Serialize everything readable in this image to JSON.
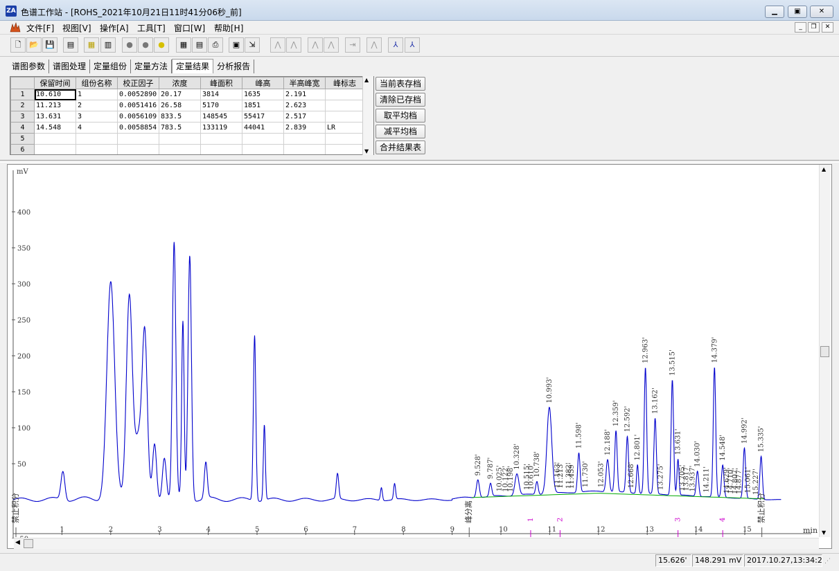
{
  "window": {
    "title": "色谱工作站 - [ROHS_2021年10月21日11时41分06秒_前]",
    "icon_label": "ZA"
  },
  "menu": [
    "文件[F]",
    "视图[V]",
    "操作[A]",
    "工具[T]",
    "窗口[W]",
    "帮助[H]"
  ],
  "tabs": [
    "谱图参数",
    "谱图处理",
    "定量组份",
    "定量方法",
    "定量结果",
    "分析报告"
  ],
  "active_tab": "定量结果",
  "results_table": {
    "headers": [
      "保留时间",
      "组份名称",
      "校正因子",
      "浓度",
      "峰面积",
      "峰高",
      "半高峰宽",
      "峰标志"
    ],
    "rows": [
      {
        "index": "1",
        "cells": [
          "10.610",
          "1",
          "0.0052890",
          "20.17",
          "3814",
          "1635",
          "2.191",
          ""
        ]
      },
      {
        "index": "2",
        "cells": [
          "11.213",
          "2",
          "0.0051416",
          "26.58",
          "5170",
          "1851",
          "2.623",
          ""
        ]
      },
      {
        "index": "3",
        "cells": [
          "13.631",
          "3",
          "0.0056109",
          "833.5",
          "148545",
          "55417",
          "2.517",
          ""
        ]
      },
      {
        "index": "4",
        "cells": [
          "14.548",
          "4",
          "0.0058854",
          "783.5",
          "133119",
          "44041",
          "2.839",
          "LR"
        ]
      },
      {
        "index": "5",
        "cells": [
          "",
          "",
          "",
          "",
          "",
          "",
          "",
          ""
        ]
      },
      {
        "index": "6",
        "cells": [
          "",
          "",
          "",
          "",
          "",
          "",
          "",
          ""
        ]
      }
    ]
  },
  "action_buttons": [
    "当前表存档",
    "清除已存档",
    "取平均档",
    "减平均档",
    "合并结果表"
  ],
  "chart_data": {
    "type": "line",
    "ylabel": "mV",
    "xlabel": "min",
    "xlim": [
      0.0,
      16.5
    ],
    "ylim": [
      -50,
      450
    ],
    "x_ticks": [
      "1",
      "2",
      "3",
      "4",
      "5",
      "6",
      "7",
      "8",
      "9",
      "10",
      "11",
      "12",
      "13",
      "14",
      "15"
    ],
    "y_ticks": [
      "-50",
      "50",
      "100",
      "150",
      "200",
      "250",
      "300",
      "350",
      "400"
    ],
    "line_color": "#0000cc",
    "baseline_color": "#00aa00",
    "peaks": [
      {
        "t": 1.02,
        "h": 40,
        "w": 0.04
      },
      {
        "t": 2.0,
        "h": 300,
        "w": 0.08
      },
      {
        "t": 2.38,
        "h": 275,
        "w": 0.06
      },
      {
        "t": 2.7,
        "h": 190,
        "w": 0.05
      },
      {
        "t": 2.58,
        "h": 90,
        "w": 0.1
      },
      {
        "t": 2.9,
        "h": 75,
        "w": 0.04
      },
      {
        "t": 3.1,
        "h": 60,
        "w": 0.04
      },
      {
        "t": 3.3,
        "h": 355,
        "w": 0.035
      },
      {
        "t": 3.48,
        "h": 245,
        "w": 0.025
      },
      {
        "t": 3.62,
        "h": 340,
        "w": 0.035
      },
      {
        "t": 3.95,
        "h": 50,
        "w": 0.03
      },
      {
        "t": 4.95,
        "h": 230,
        "w": 0.025
      },
      {
        "t": 5.15,
        "h": 105,
        "w": 0.02
      },
      {
        "t": 6.65,
        "h": 35,
        "w": 0.025
      },
      {
        "t": 7.55,
        "h": 18,
        "w": 0.02
      },
      {
        "t": 7.82,
        "h": 22,
        "w": 0.02
      },
      {
        "t": 9.528,
        "h": 25,
        "w": 0.03
      },
      {
        "t": 9.787,
        "h": 18,
        "w": 0.025
      },
      {
        "t": 10.328,
        "h": 30,
        "w": 0.04
      },
      {
        "t": 10.738,
        "h": 18,
        "w": 0.025
      },
      {
        "t": 10.993,
        "h": 120,
        "w": 0.05
      },
      {
        "t": 11.598,
        "h": 55,
        "w": 0.025
      },
      {
        "t": 12.188,
        "h": 45,
        "w": 0.03
      },
      {
        "t": 12.359,
        "h": 85,
        "w": 0.025
      },
      {
        "t": 12.592,
        "h": 78,
        "w": 0.025
      },
      {
        "t": 12.801,
        "h": 40,
        "w": 0.02
      },
      {
        "t": 12.963,
        "h": 175,
        "w": 0.025
      },
      {
        "t": 13.162,
        "h": 105,
        "w": 0.025
      },
      {
        "t": 13.515,
        "h": 160,
        "w": 0.025
      },
      {
        "t": 13.631,
        "h": 50,
        "w": 0.02
      },
      {
        "t": 14.03,
        "h": 35,
        "w": 0.025
      },
      {
        "t": 14.379,
        "h": 180,
        "w": 0.025
      },
      {
        "t": 14.548,
        "h": 45,
        "w": 0.025
      },
      {
        "t": 14.992,
        "h": 70,
        "w": 0.025
      },
      {
        "t": 15.335,
        "h": 60,
        "w": 0.025
      }
    ],
    "peak_labels": [
      {
        "t": 9.528,
        "text": "9.528'"
      },
      {
        "t": 9.787,
        "text": "9.787'"
      },
      {
        "t": 9.97,
        "text": "10.025'"
      },
      {
        "t": 10.09,
        "text": "10.122'"
      },
      {
        "t": 10.198,
        "text": "10.198'"
      },
      {
        "t": 10.328,
        "text": "10.328'"
      },
      {
        "t": 10.53,
        "text": "10.515'"
      },
      {
        "t": 10.62,
        "text": "10.610'"
      },
      {
        "t": 10.738,
        "text": "10.738'"
      },
      {
        "t": 10.993,
        "text": "10.993'"
      },
      {
        "t": 11.16,
        "text": "11.163'"
      },
      {
        "t": 11.22,
        "text": "11.213'"
      },
      {
        "t": 11.39,
        "text": "11.382'"
      },
      {
        "t": 11.45,
        "text": "11.459'"
      },
      {
        "t": 11.598,
        "text": "11.598'"
      },
      {
        "t": 11.73,
        "text": "11.730'"
      },
      {
        "t": 12.053,
        "text": "12.053'"
      },
      {
        "t": 12.188,
        "text": "12.188'"
      },
      {
        "t": 12.359,
        "text": "12.359'"
      },
      {
        "t": 12.592,
        "text": "12.592'"
      },
      {
        "t": 12.668,
        "text": "12.668'"
      },
      {
        "t": 12.801,
        "text": "12.801'"
      },
      {
        "t": 12.963,
        "text": "12.963'"
      },
      {
        "t": 13.162,
        "text": "13.162'"
      },
      {
        "t": 13.275,
        "text": "13.275'"
      },
      {
        "t": 13.515,
        "text": "13.515'"
      },
      {
        "t": 13.631,
        "text": "13.631'"
      },
      {
        "t": 13.72,
        "text": "13.705'"
      },
      {
        "t": 13.8,
        "text": "13.817'"
      },
      {
        "t": 13.93,
        "text": "13.937'"
      },
      {
        "t": 14.03,
        "text": "14.030'"
      },
      {
        "t": 14.211,
        "text": "14.211'"
      },
      {
        "t": 14.379,
        "text": "14.379'"
      },
      {
        "t": 14.548,
        "text": "14.548'"
      },
      {
        "t": 14.63,
        "text": "14.629'"
      },
      {
        "t": 14.71,
        "text": "14.710'"
      },
      {
        "t": 14.8,
        "text": "14.807'"
      },
      {
        "t": 14.877,
        "text": "14.877'"
      },
      {
        "t": 14.992,
        "text": "14.992'"
      },
      {
        "t": 15.061,
        "text": "15.061'"
      },
      {
        "t": 15.227,
        "text": "15.227'"
      },
      {
        "t": 15.335,
        "text": "15.335'"
      }
    ],
    "markers": [
      {
        "t": 0.0,
        "text": "禁止积分"
      },
      {
        "t": 9.35,
        "text": "峰分离"
      },
      {
        "t": 15.35,
        "text": "禁止积分"
      }
    ],
    "component_marks": [
      {
        "t": 10.61,
        "text": "1"
      },
      {
        "t": 11.213,
        "text": "2"
      },
      {
        "t": 13.631,
        "text": "3"
      },
      {
        "t": 14.548,
        "text": "4"
      }
    ]
  },
  "status": {
    "time": "15.626'",
    "signal": "148.291 mV",
    "datetime": "2017.10.27,13:34:20"
  }
}
